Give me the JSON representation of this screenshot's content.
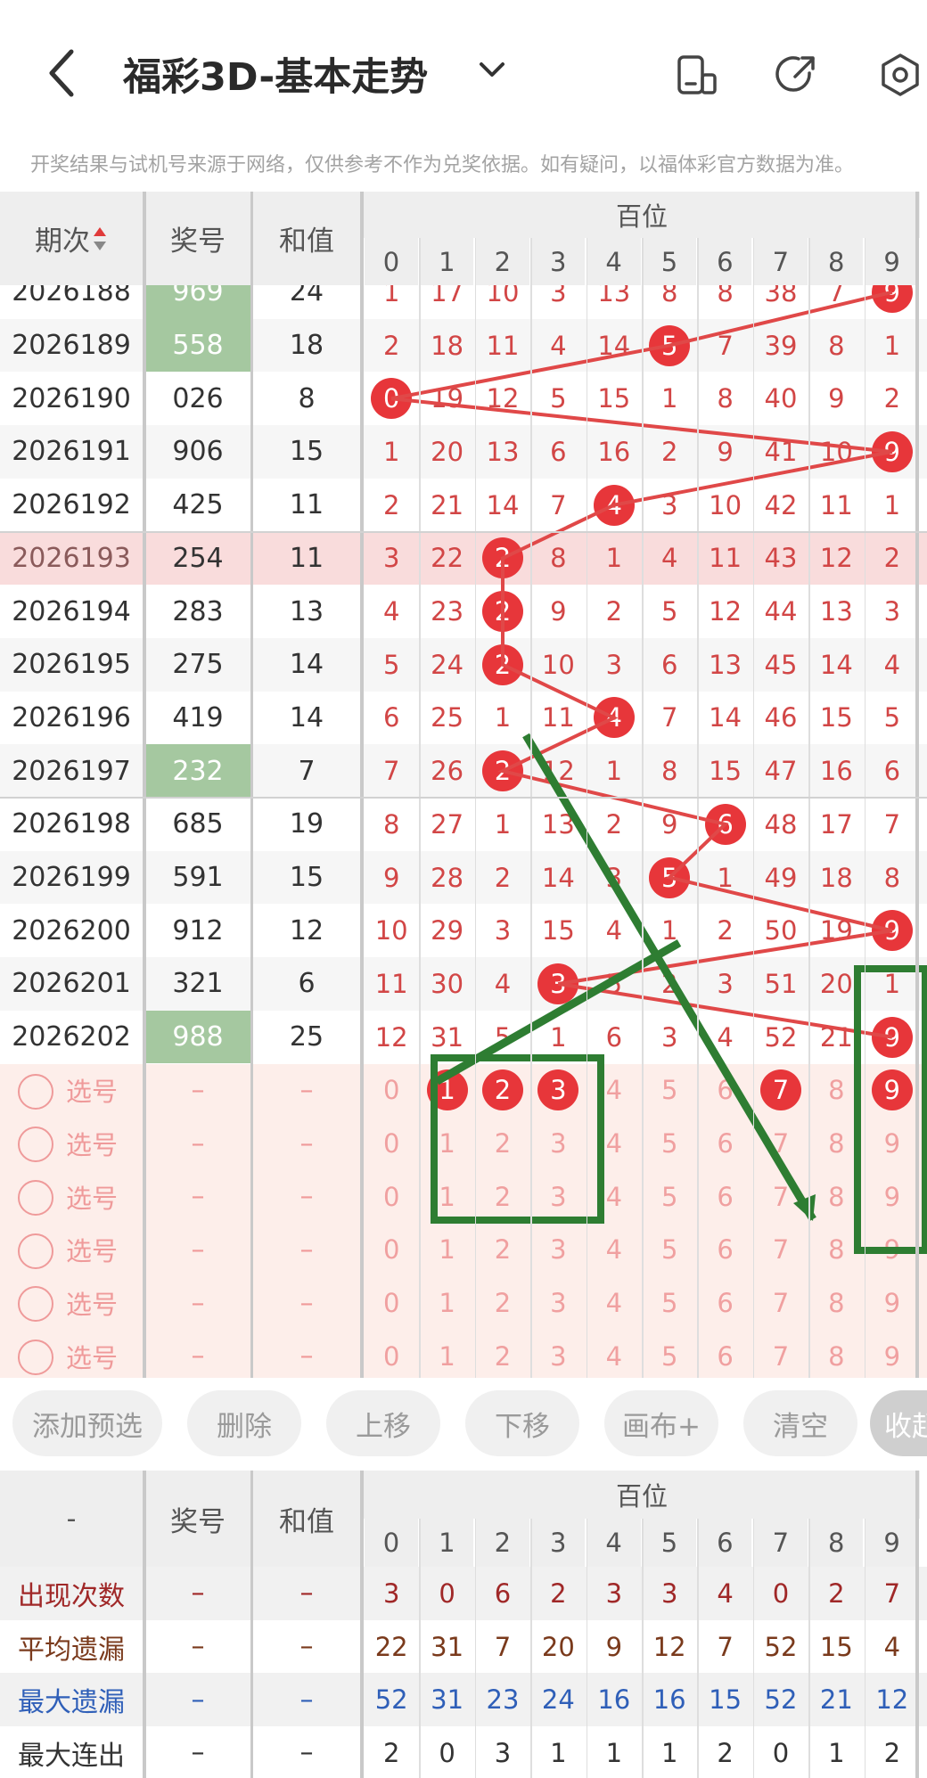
{
  "header": {
    "title": "福彩3D-基本走势",
    "notice": "开奖结果与试机号来源于网络，仅供参考不作为兑奖依据。如有疑问，以福体彩官方数据为准。"
  },
  "table": {
    "col_issue": "期次",
    "col_prize": "奖号",
    "col_sum": "和值",
    "group": "百位",
    "digits": [
      "0",
      "1",
      "2",
      "3",
      "4",
      "5",
      "6",
      "7",
      "8",
      "9"
    ],
    "rows": [
      {
        "issue": "2026188",
        "prize": "969",
        "sum": "24",
        "cells": [
          "1",
          "17",
          "10",
          "3",
          "13",
          "8",
          "8",
          "38",
          "7",
          "9"
        ],
        "hit": 9,
        "highlight_prize": true
      },
      {
        "issue": "2026189",
        "prize": "558",
        "sum": "18",
        "cells": [
          "2",
          "18",
          "11",
          "4",
          "14",
          "5",
          "7",
          "39",
          "8",
          "1"
        ],
        "hit": 5,
        "highlight_prize": true
      },
      {
        "issue": "2026190",
        "prize": "026",
        "sum": "8",
        "cells": [
          "0",
          "19",
          "12",
          "5",
          "15",
          "1",
          "8",
          "40",
          "9",
          "2"
        ],
        "hit": 0
      },
      {
        "issue": "2026191",
        "prize": "906",
        "sum": "15",
        "cells": [
          "1",
          "20",
          "13",
          "6",
          "16",
          "2",
          "9",
          "41",
          "10",
          "9"
        ],
        "hit": 9
      },
      {
        "issue": "2026192",
        "prize": "425",
        "sum": "11",
        "cells": [
          "2",
          "21",
          "14",
          "7",
          "4",
          "3",
          "10",
          "42",
          "11",
          "1"
        ],
        "hit": 4
      },
      {
        "issue": "2026193",
        "prize": "254",
        "sum": "11",
        "cells": [
          "3",
          "22",
          "2",
          "8",
          "1",
          "4",
          "11",
          "43",
          "12",
          "2"
        ],
        "hit": 2,
        "selected": true
      },
      {
        "issue": "2026194",
        "prize": "283",
        "sum": "13",
        "cells": [
          "4",
          "23",
          "2",
          "9",
          "2",
          "5",
          "12",
          "44",
          "13",
          "3"
        ],
        "hit": 2
      },
      {
        "issue": "2026195",
        "prize": "275",
        "sum": "14",
        "cells": [
          "5",
          "24",
          "2",
          "10",
          "3",
          "6",
          "13",
          "45",
          "14",
          "4"
        ],
        "hit": 2
      },
      {
        "issue": "2026196",
        "prize": "419",
        "sum": "14",
        "cells": [
          "6",
          "25",
          "1",
          "11",
          "4",
          "7",
          "14",
          "46",
          "15",
          "5"
        ],
        "hit": 4
      },
      {
        "issue": "2026197",
        "prize": "232",
        "sum": "7",
        "cells": [
          "7",
          "26",
          "2",
          "12",
          "1",
          "8",
          "15",
          "47",
          "16",
          "6"
        ],
        "hit": 2,
        "highlight_prize": true
      },
      {
        "issue": "2026198",
        "prize": "685",
        "sum": "19",
        "cells": [
          "8",
          "27",
          "1",
          "13",
          "2",
          "9",
          "6",
          "48",
          "17",
          "7"
        ],
        "hit": 6
      },
      {
        "issue": "2026199",
        "prize": "591",
        "sum": "15",
        "cells": [
          "9",
          "28",
          "2",
          "14",
          "3",
          "5",
          "1",
          "49",
          "18",
          "8"
        ],
        "hit": 5
      },
      {
        "issue": "2026200",
        "prize": "912",
        "sum": "12",
        "cells": [
          "10",
          "29",
          "3",
          "15",
          "4",
          "1",
          "2",
          "50",
          "19",
          "9"
        ],
        "hit": 9
      },
      {
        "issue": "2026201",
        "prize": "321",
        "sum": "6",
        "cells": [
          "11",
          "30",
          "4",
          "3",
          "5",
          "2",
          "3",
          "51",
          "20",
          "1"
        ],
        "hit": 3
      },
      {
        "issue": "2026202",
        "prize": "988",
        "sum": "25",
        "cells": [
          "12",
          "31",
          "5",
          "1",
          "6",
          "3",
          "4",
          "52",
          "21",
          "9"
        ],
        "hit": 9,
        "highlight_prize": true
      }
    ],
    "pick_label": "选号",
    "dash": "–",
    "pick_rows": [
      {
        "balls": [
          1,
          2,
          3,
          7,
          9
        ]
      },
      {
        "balls": []
      },
      {
        "balls": []
      },
      {
        "balls": []
      },
      {
        "balls": []
      },
      {
        "balls": []
      }
    ]
  },
  "buttons": [
    "添加预选",
    "删除",
    "上移",
    "下移",
    "画布+",
    "清空",
    "收起"
  ],
  "stats": {
    "corner": "-",
    "col_prize": "奖号",
    "col_sum": "和值",
    "group": "百位",
    "dash": "–",
    "rows": [
      {
        "label": "出现次数",
        "color": "#a02828",
        "values": [
          "3",
          "0",
          "6",
          "2",
          "3",
          "3",
          "4",
          "0",
          "2",
          "7"
        ]
      },
      {
        "label": "平均遗漏",
        "color": "#7a3a1c",
        "values": [
          "22",
          "31",
          "7",
          "20",
          "9",
          "12",
          "7",
          "52",
          "15",
          "4"
        ]
      },
      {
        "label": "最大遗漏",
        "color": "#2f5fb8",
        "values": [
          "52",
          "31",
          "23",
          "24",
          "16",
          "16",
          "15",
          "52",
          "21",
          "12"
        ]
      },
      {
        "label": "最大连出",
        "color": "#333333",
        "values": [
          "2",
          "0",
          "3",
          "1",
          "1",
          "1",
          "2",
          "0",
          "1",
          "2"
        ]
      }
    ]
  },
  "colors": {
    "ball": "#e7363a",
    "trend_line": "#e04848",
    "annotation": "#2e7d32",
    "highlight_prize": "#a5c8a0",
    "selected_row": "#f9dcdc",
    "pick_bg": "#fdeeea"
  }
}
